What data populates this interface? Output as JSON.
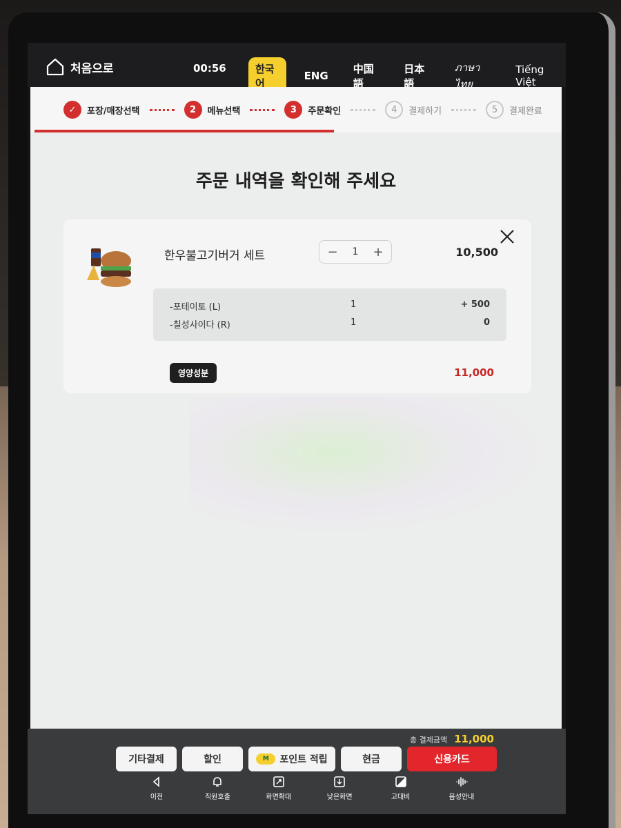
{
  "top_bar": {
    "home_label": "처음으로",
    "timer": "00:56",
    "languages": [
      "한국어",
      "ENG",
      "中国語",
      "日本語",
      "ภาษาไทย",
      "Tiếng Việt"
    ],
    "active_language": "한국어"
  },
  "steps": [
    {
      "number": "✓",
      "label": "포장/매장선택",
      "state": "done"
    },
    {
      "number": "2",
      "label": "메뉴선택",
      "state": "done"
    },
    {
      "number": "3",
      "label": "주문확인",
      "state": "current"
    },
    {
      "number": "4",
      "label": "결제하기",
      "state": "pending"
    },
    {
      "number": "5",
      "label": "결제완료",
      "state": "pending"
    }
  ],
  "page_title": "주문 내역을 확인해 주세요",
  "order": {
    "item_name": "한우불고기버거 세트",
    "quantity": "1",
    "price": "10,500",
    "options": [
      {
        "name": "-포테이토 (L)",
        "qty": "1",
        "price": "+ 500"
      },
      {
        "name": "-칠성사이다 (R)",
        "qty": "1",
        "price": "0"
      }
    ],
    "nutrition_label": "영양성분",
    "item_total": "11,000"
  },
  "payment": {
    "total_label": "총 결제금액",
    "total_amount": "11,000",
    "buttons": [
      "기타결제",
      "할인",
      "포인트 적립",
      "현금",
      "신용카드"
    ],
    "point_badge": "M"
  },
  "accessibility": [
    "이전",
    "직원호출",
    "화면확대",
    "낮은화면",
    "고대비",
    "음성안내"
  ],
  "colors": {
    "accent_red": "#d32f2f",
    "highlight_yellow": "#f5cf2e",
    "card_button": "#e3262c"
  }
}
